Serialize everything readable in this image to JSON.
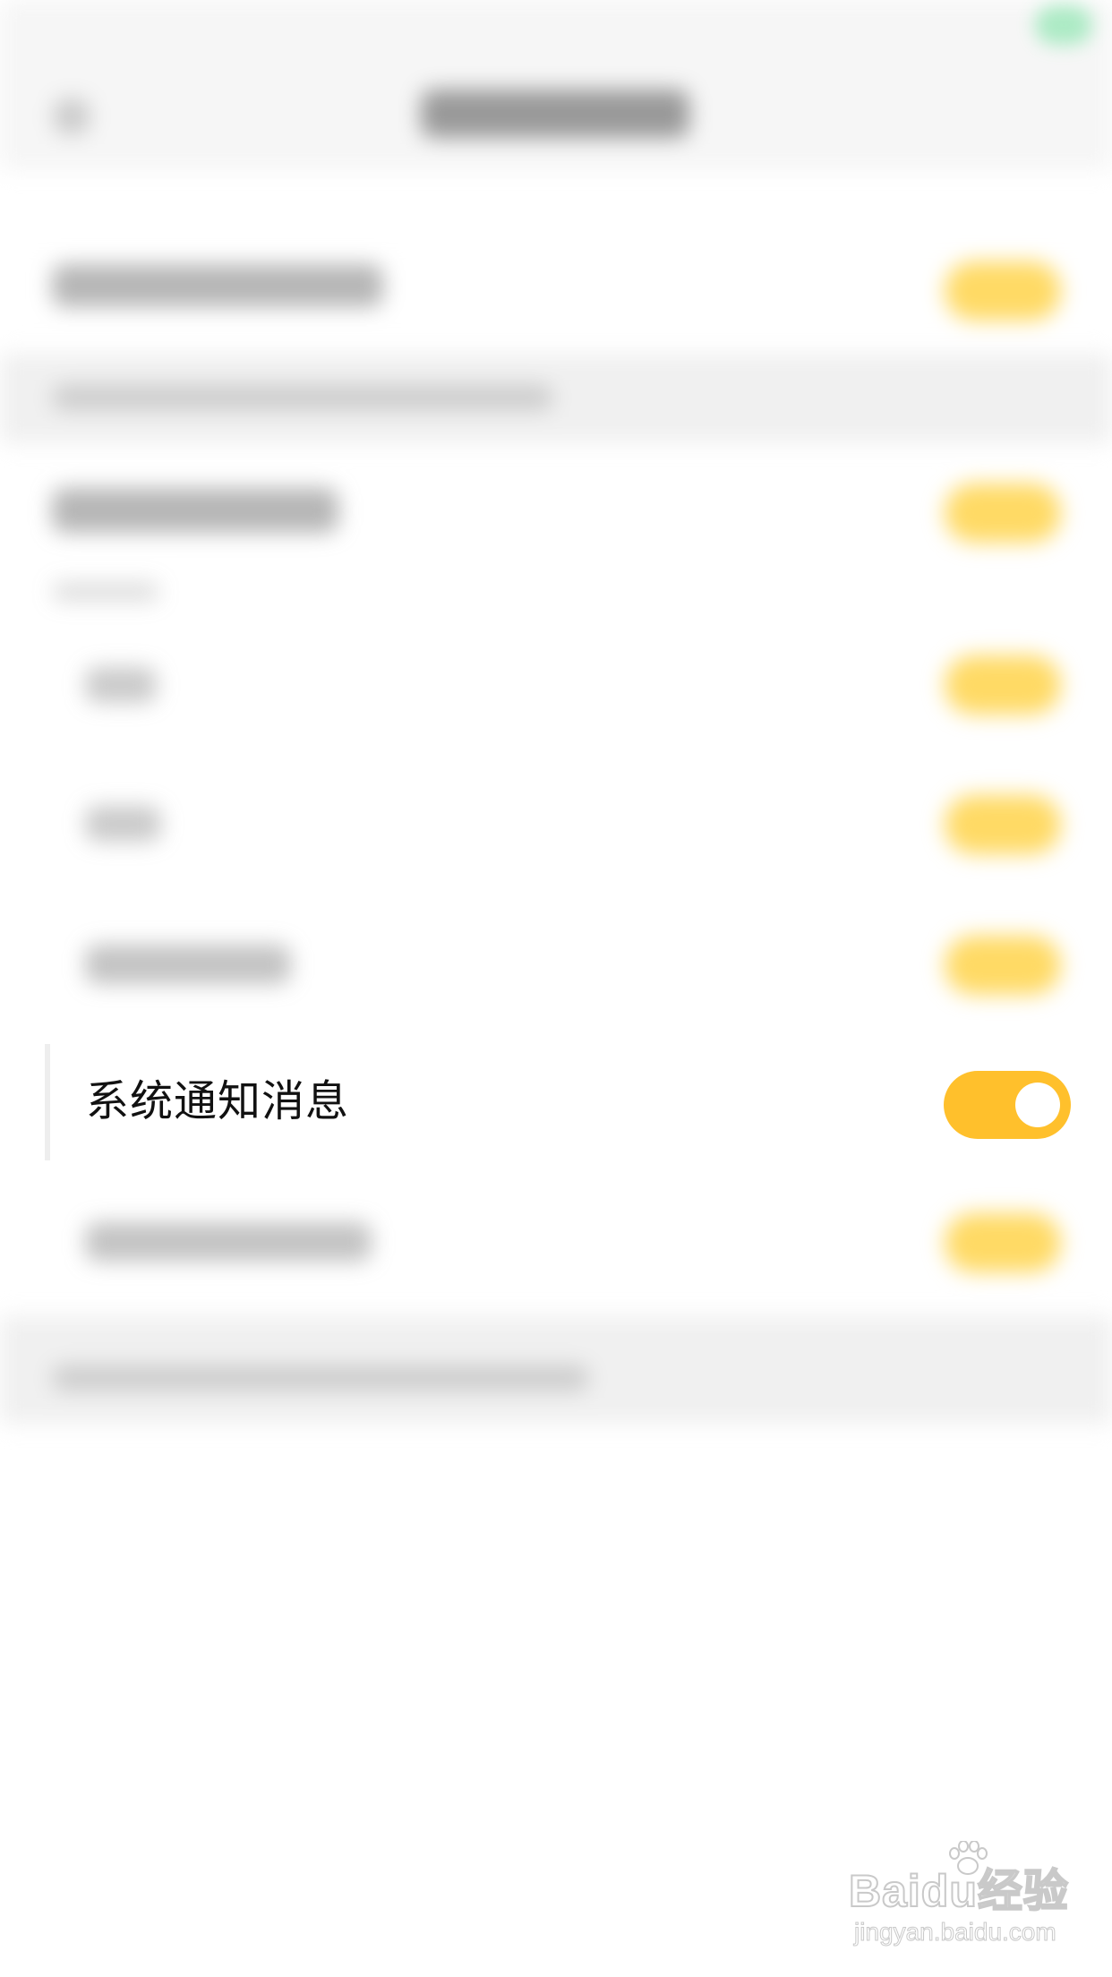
{
  "row": {
    "label": "系统通知消息",
    "toggle_on": true
  },
  "colors": {
    "toggle_on": "#ffc02c",
    "toggle_blurred": "#ffd34a",
    "background": "#ffffff"
  },
  "watermark": {
    "brand": "Baidu经验",
    "url": "jingyan.baidu.com"
  }
}
